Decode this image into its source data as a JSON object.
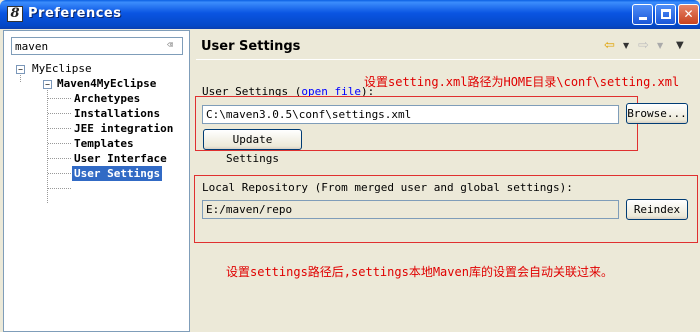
{
  "window": {
    "title": "Preferences",
    "app_icon": "eclipse-icon",
    "app_icon_glyph": "8"
  },
  "sidebar": {
    "filter_value": "maven",
    "tree": [
      {
        "label": "MyEclipse",
        "expanded": true
      },
      {
        "label": "Maven4MyEclipse",
        "expanded": true,
        "bold": true
      },
      {
        "label": "Archetypes"
      },
      {
        "label": "Installations"
      },
      {
        "label": "JEE integration"
      },
      {
        "label": "Templates"
      },
      {
        "label": "User Interface"
      },
      {
        "label": "User Settings",
        "selected": true
      }
    ]
  },
  "page": {
    "title": "User Settings",
    "user_settings_label": "User Settings (",
    "open_file_link": "open file",
    "user_settings_label_end": "):",
    "settings_path": "C:\\maven3.0.5\\conf\\settings.xml",
    "browse_button": "Browse...",
    "update_button": "Update Settings",
    "local_repo_label": "Local Repository (From merged user and global settings):",
    "local_repo_path": "E:/maven/repo",
    "reindex_button": "Reindex"
  },
  "annotations": {
    "note1": "设置setting.xml路径为HOME目录\\conf\\setting.xml",
    "note2": "设置settings路径后,settings本地Maven库的设置会自动关联过来。",
    "color": "#e00000"
  },
  "colors": {
    "selection": "#316ac5",
    "titlebar": "#0a55e2",
    "dialog_bg": "#ece9d8"
  }
}
